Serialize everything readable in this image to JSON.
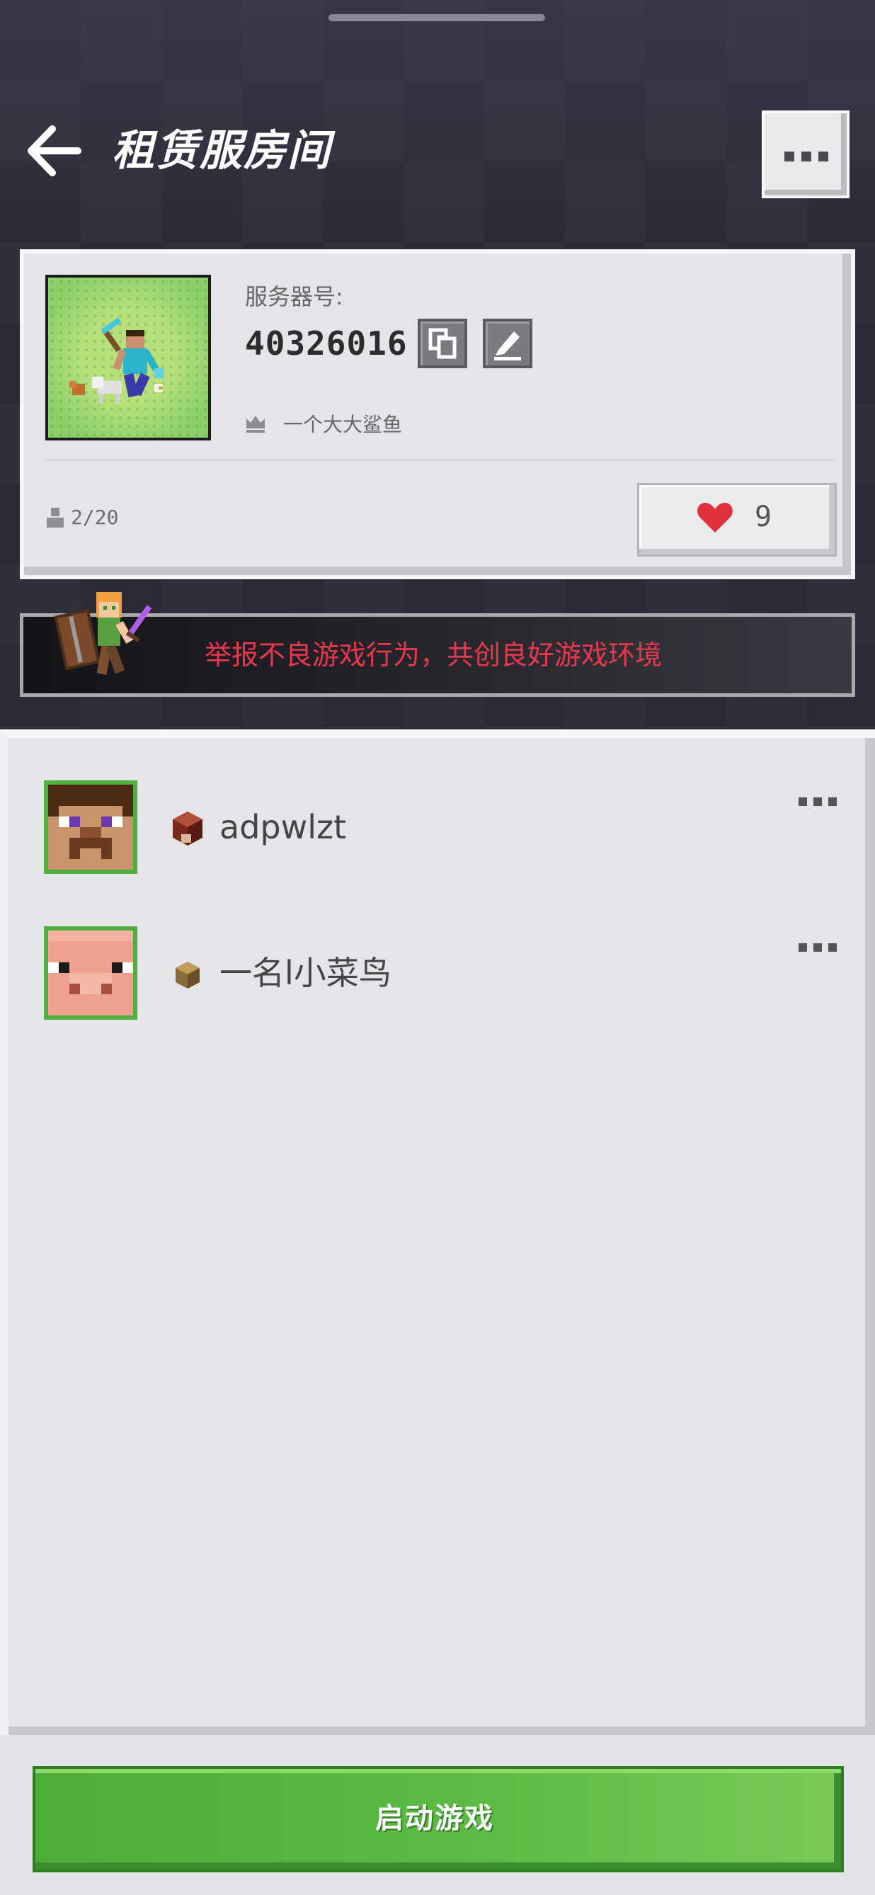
{
  "header": {
    "title": "租赁服房间",
    "back_icon": "arrow-left-icon",
    "more_icon": "more-dots-icon"
  },
  "server": {
    "label": "服务器号:",
    "number": "40326016",
    "copy_icon": "copy-icon",
    "edit_icon": "edit-pencil-icon",
    "owner_icon": "crown-icon",
    "owner_name": "一个大大鲨鱼",
    "players_icon": "person-icon",
    "players": "2/20",
    "like_icon": "heart-icon",
    "likes": "9"
  },
  "banner": {
    "text": "举报不良游戏行为，共创良好游戏环境",
    "text_color": "#e8384d"
  },
  "players": [
    {
      "name": "adpwlzt",
      "avatar": "steve-face",
      "level_icon": "redstone-block-icon"
    },
    {
      "name": "一名l小菜鸟",
      "avatar": "pig-face",
      "level_icon": "wood-block-icon"
    }
  ],
  "actions": {
    "start_label": "启动游戏",
    "start_color": "#5cbb44"
  }
}
